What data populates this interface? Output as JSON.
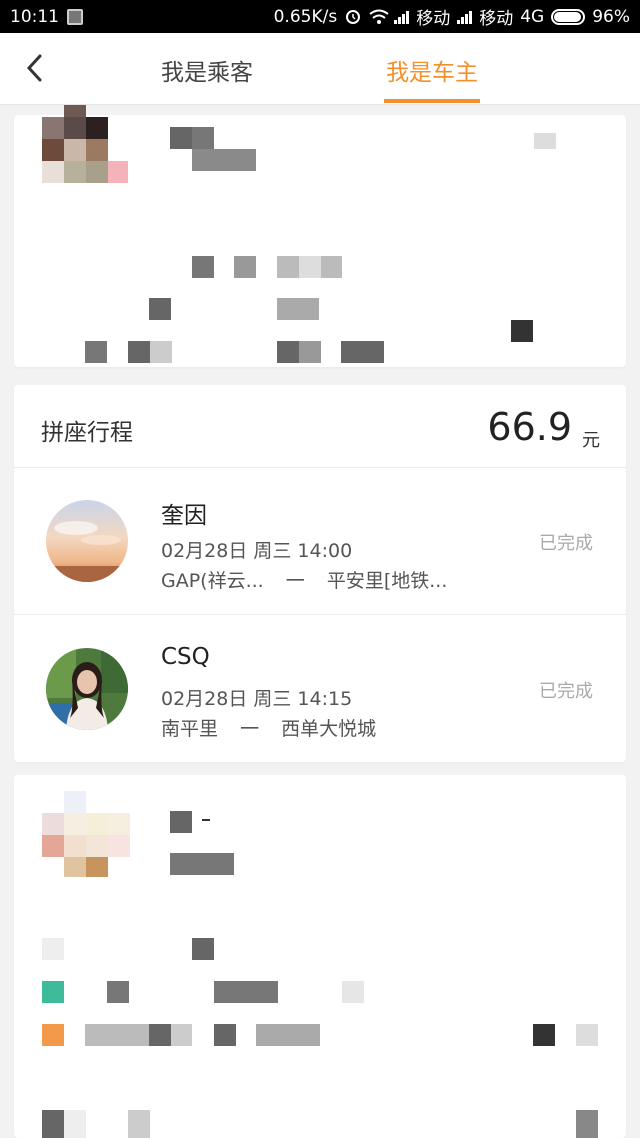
{
  "status_bar": {
    "time": "10:11",
    "net_speed": "0.65K/s",
    "carrier1": "移动",
    "carrier2": "移动",
    "network": "4G",
    "battery": "96%"
  },
  "header": {
    "tabs": [
      {
        "label": "我是乘客",
        "active": false
      },
      {
        "label": "我是车主",
        "active": true
      }
    ],
    "accent_color": "#f39029"
  },
  "trip_card": {
    "title": "拼座行程",
    "amount": "66.9",
    "unit": "元",
    "trips": [
      {
        "name": "奎因",
        "time": "02月28日 周三 14:00",
        "from": "GAP(祥云...",
        "arrow": "一",
        "to": "平安里[地铁...",
        "status": "已完成"
      },
      {
        "name": "CSQ",
        "time": "02月28日 周三 14:15",
        "from": "南平里",
        "arrow": "一",
        "to": "西单大悦城",
        "status": "已完成"
      }
    ]
  }
}
